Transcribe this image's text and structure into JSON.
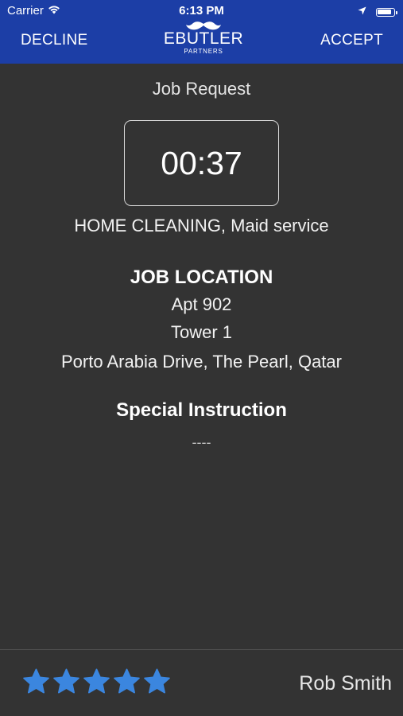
{
  "status_bar": {
    "carrier": "Carrier",
    "time": "6:13 PM",
    "battery_level": 0.95
  },
  "nav": {
    "decline_label": "DECLINE",
    "accept_label": "ACCEPT",
    "logo_word": "EBUTLER",
    "logo_sub": "PARTNERS"
  },
  "job": {
    "title": "Job Request",
    "countdown": "00:37",
    "service": "HOME CLEANING, Maid service",
    "location_heading": "JOB LOCATION",
    "location_lines": [
      "Apt 902",
      "Tower 1",
      "Porto Arabia Drive, The Pearl, Qatar"
    ],
    "instruction_heading": "Special Instruction",
    "instruction_text": "----"
  },
  "footer": {
    "rating": 5,
    "rating_max": 5,
    "worker_name": "Rob Smith"
  },
  "colors": {
    "header_bg": "#1c3ea6",
    "page_bg": "#333333",
    "star": "#3b86df"
  },
  "icons": {
    "wifi": "wifi-icon",
    "location": "location-arrow-icon",
    "battery": "battery-icon",
    "mustache": "mustache-icon",
    "star": "star-icon"
  }
}
